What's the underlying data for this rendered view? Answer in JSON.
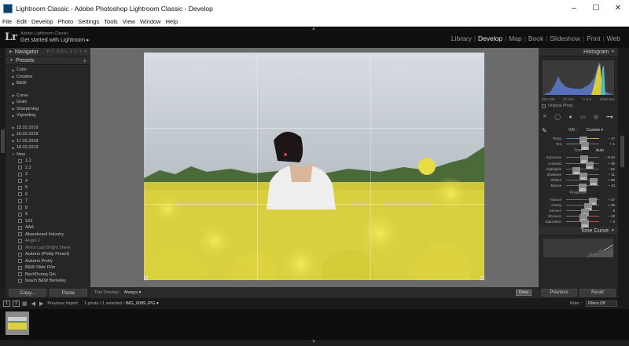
{
  "window": {
    "title": "Lightroom Classic - Adobe Photoshop Lightroom Classic - Develop",
    "controls": [
      "–",
      "☐",
      "✕"
    ]
  },
  "menu": [
    "File",
    "Edit",
    "Develop",
    "Photo",
    "Settings",
    "Tools",
    "View",
    "Window",
    "Help"
  ],
  "identity": {
    "logo": "Lr",
    "line1": "Adobe Lightroom Classic",
    "line2": "Get started with Lightroom ▸"
  },
  "modules": [
    {
      "label": "Library",
      "active": false
    },
    {
      "label": "Develop",
      "active": true
    },
    {
      "label": "Map",
      "active": false
    },
    {
      "label": "Book",
      "active": false
    },
    {
      "label": "Slideshow",
      "active": false
    },
    {
      "label": "Print",
      "active": false
    },
    {
      "label": "Web",
      "active": false
    }
  ],
  "left_panel": {
    "navigator": {
      "title": "Navigator",
      "fit": "FIT FILL 1:1 1:4"
    },
    "presets": {
      "title": "Presets",
      "plus": "+",
      "groups_a": [
        "Color",
        "Creative",
        "B&W"
      ],
      "groups_b": [
        "Curve",
        "Grain",
        "Sharpening",
        "Vignetting"
      ],
      "groups_c": [
        "15.02.2019",
        "16.02.2019",
        "17.02.2019",
        "18.02.2019",
        "New"
      ],
      "new_children": [
        "1.2",
        "2.2",
        "3",
        "4",
        "5",
        "6",
        "7",
        "8",
        "9",
        "123",
        "AAA",
        "Abandoned Industry",
        "Angel 2",
        "Ann's Last Bright Sheet",
        "Autumn (Pretty Preset)",
        "Autumn Pretty",
        "B&W Slide Film",
        "BachDuong Gin",
        "beach B&W Berkeley"
      ]
    },
    "buttons": {
      "copy": "Copy...",
      "paste": "Paste"
    }
  },
  "toolbar": {
    "overlay_label": "Tool Overlay :",
    "overlay_value": "Always ▾",
    "done": "Done"
  },
  "right_panel": {
    "histogram": {
      "title": "Histogram",
      "exif": [
        "ISO 100",
        "27 mm",
        "f / 3.2",
        "1/640 sec"
      ],
      "original": "Original Photo"
    },
    "tools": [
      "⌗",
      "◯",
      "●",
      "▭",
      "◎",
      "━●"
    ],
    "basic": {
      "wb_label": "WB :",
      "wb_value": "Custom ▾",
      "temp": {
        "label": "Temp",
        "value": "− 17",
        "pos": 0.46
      },
      "tint": {
        "label": "Tint",
        "value": "+ 1",
        "pos": 0.51
      },
      "tone_label": "Tone",
      "auto": "Auto",
      "exposure": {
        "label": "Exposure",
        "value": "− 0.24",
        "pos": 0.48
      },
      "contrast": {
        "label": "Contrast",
        "value": "+ 30",
        "pos": 0.65
      },
      "highlights": {
        "label": "Highlights",
        "value": "− 52",
        "pos": 0.24
      },
      "shadows": {
        "label": "Shadows",
        "value": "− 11",
        "pos": 0.45
      },
      "whites": {
        "label": "Whites",
        "value": "+ 50",
        "pos": 0.75
      },
      "blacks": {
        "label": "Blacks",
        "value": "− 14",
        "pos": 0.43
      },
      "presence_label": "Presence",
      "texture": {
        "label": "Texture",
        "value": "+ 47",
        "pos": 0.74
      },
      "clarity": {
        "label": "Clarity",
        "value": "+ 20",
        "pos": 0.6
      },
      "dehaze": {
        "label": "Dehaze",
        "value": "0",
        "pos": 0.5
      },
      "vibrance": {
        "label": "Vibrance",
        "value": "− 10",
        "pos": 0.45
      },
      "saturation": {
        "label": "Saturation",
        "value": "− 3",
        "pos": 0.49
      }
    },
    "tone_curve": {
      "title": "Tone Curve"
    },
    "buttons": {
      "previous": "Previous",
      "reset": "Reset"
    }
  },
  "filmbar": {
    "view1": "1",
    "view2": "2",
    "source": "Previous Import",
    "count": "1 photo / 1 selected /",
    "file": "IMG_0089.JPG ▾",
    "filter_label": "Filter :",
    "filter_value": "Filters Off"
  },
  "colors": {
    "panel_bg": "#262626",
    "center_bg": "#6b6b6b",
    "sky": "#c9cfd4",
    "flowers": "#d9d23c"
  }
}
